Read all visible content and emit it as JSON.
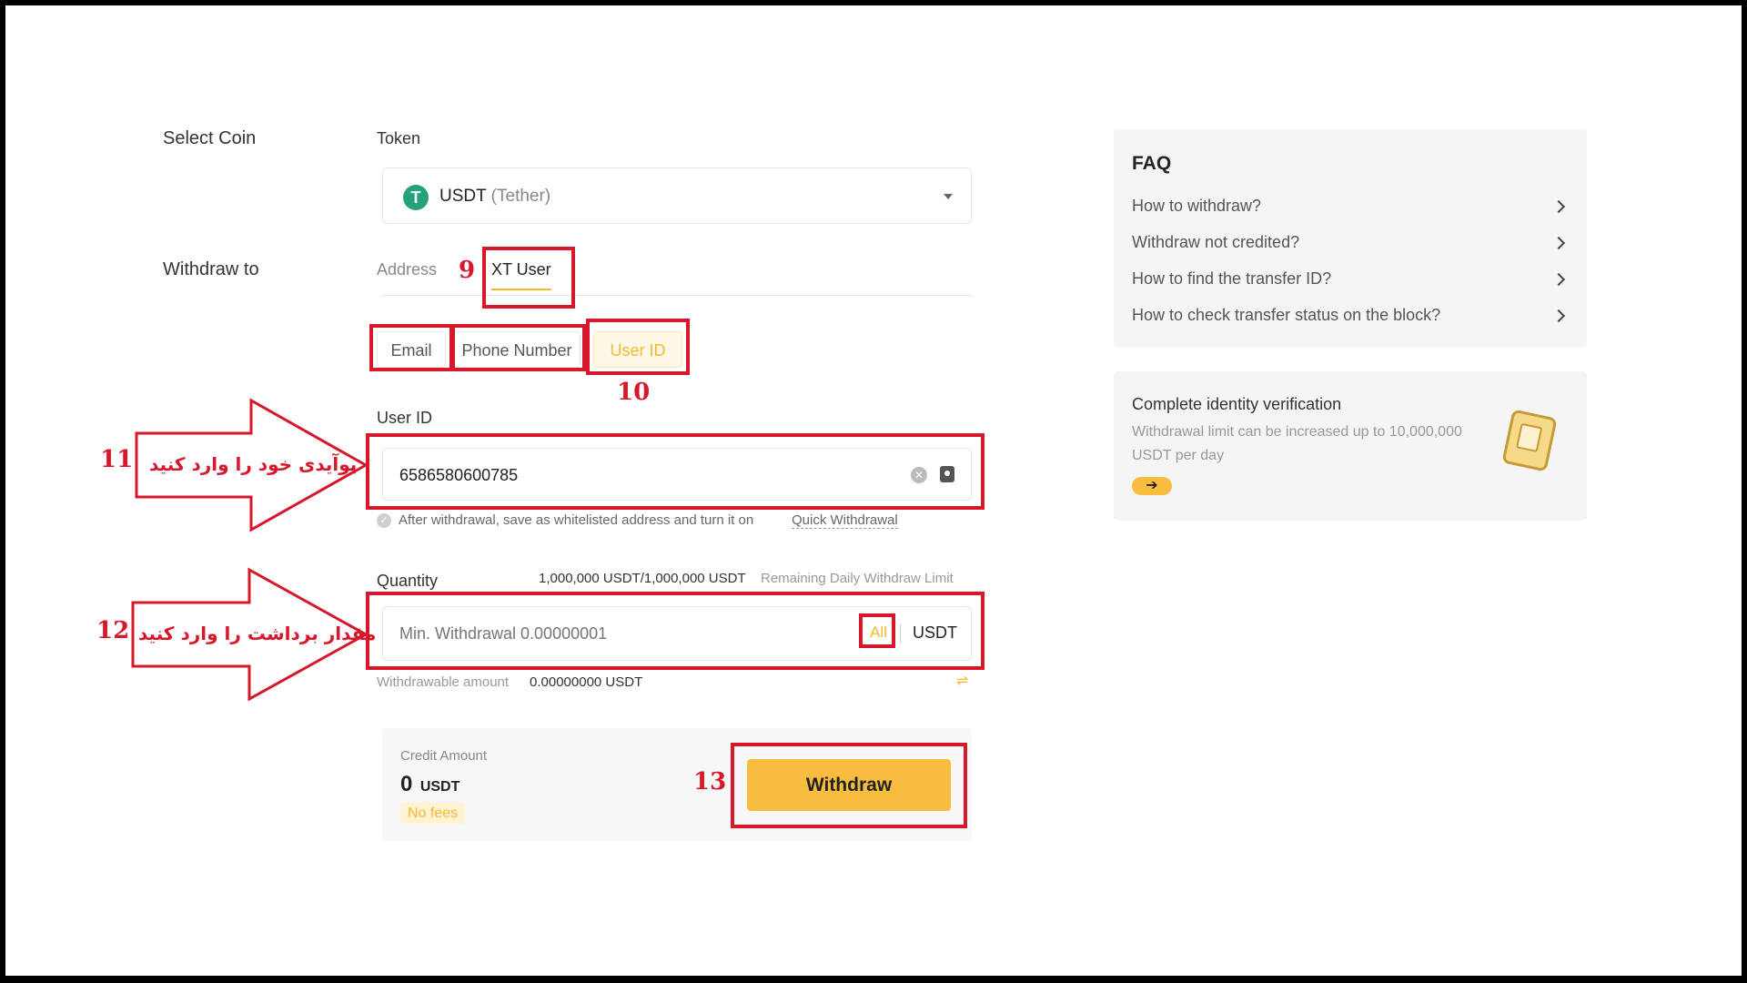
{
  "labels": {
    "select_coin": "Select Coin",
    "token": "Token",
    "withdraw_to": "Withdraw to",
    "user_id_label": "User ID",
    "quantity": "Quantity"
  },
  "token": {
    "logo_glyph": "T",
    "symbol": "USDT",
    "name": "(Tether)",
    "brand_color": "#26a17b"
  },
  "withdraw_tabs": {
    "address": "Address",
    "xt_user": "XT User"
  },
  "recipient_types": {
    "email": "Email",
    "phone": "Phone Number",
    "user_id": "User ID"
  },
  "user_id_input": {
    "value": "6586580600785"
  },
  "whitelist": {
    "text": "After withdrawal, save as whitelisted address and turn it on",
    "link": "Quick Withdrawal"
  },
  "quantity": {
    "limit_value": "1,000,000 USDT/1,000,000 USDT",
    "limit_label": "Remaining Daily Withdraw Limit",
    "placeholder": "Min. Withdrawal 0.00000001",
    "all": "All",
    "unit": "USDT",
    "withdrawable_label": "Withdrawable amount",
    "withdrawable_value": "0.00000000 USDT"
  },
  "credit": {
    "label": "Credit Amount",
    "amount": "0",
    "unit": "USDT",
    "fees": "No fees",
    "withdraw_button": "Withdraw"
  },
  "faq": {
    "title": "FAQ",
    "items": [
      "How to withdraw?",
      "Withdraw not credited?",
      "How to find the transfer ID?",
      "How to check transfer status on the block?"
    ]
  },
  "kyc": {
    "title": "Complete identity verification",
    "desc_line1": "Withdrawal limit can be increased up to 10,000,000",
    "desc_line2": "USDT per day",
    "arrow": "➔"
  },
  "annotations": {
    "n9": "9",
    "n10": "10",
    "n11": "11",
    "n12": "12",
    "n13": "13",
    "arrow11_text": "یوآیدی خود را وارد کنید",
    "arrow12_text": "مقدار برداشت را وارد کنید",
    "color": "#d7182a"
  },
  "colors": {
    "accent": "#f5b82e",
    "button": "#f8bd3f"
  }
}
